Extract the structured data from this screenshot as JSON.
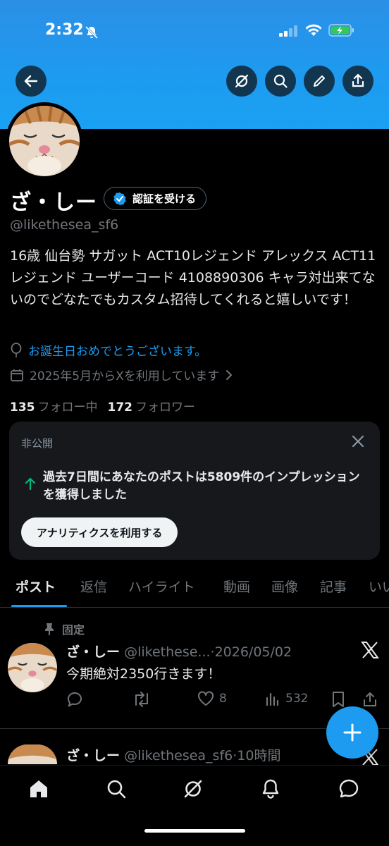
{
  "status_bar": {
    "time": "2:32"
  },
  "profile": {
    "name": "ざ・しー",
    "verify_label": "認証を受ける",
    "handle": "@likethesea_sf6",
    "bio": "16歳 仙台勢 サガット ACT10レジェンド アレックス ACT11レジェンド ユーザーコード 4108890306 キャラ対出来てないのでどなたでもカスタム招待してくれると嬉しいです！",
    "birthday": "お誕生日おめでとうございます。",
    "joined": "2025年5月からXを利用しています",
    "following_count": "135",
    "following_label": "フォロー中",
    "followers_count": "172",
    "followers_label": "フォロワー"
  },
  "private_card": {
    "label": "非公開",
    "text": "過去7日間にあなたのポストは5809件のインプレッションを獲得しました",
    "button": "アナリティクスを利用する"
  },
  "tabs": [
    {
      "label": "ポスト"
    },
    {
      "label": "返信"
    },
    {
      "label": "ハイライト"
    },
    {
      "label": "動画"
    },
    {
      "label": "画像"
    },
    {
      "label": "記事"
    },
    {
      "label": "いい"
    }
  ],
  "posts": [
    {
      "pinned_label": "固定",
      "name": "ざ・しー",
      "handle": "@likethese...",
      "separator": "·",
      "date": "2026/05/02",
      "text": "今期絶対2350行きます！",
      "likes": "8",
      "views": "532"
    },
    {
      "name": "ざ・しー",
      "handle": "@likethesea_sf6",
      "separator": "·",
      "date": "10時間"
    }
  ],
  "colors": {
    "accent": "#1d9bf0",
    "background": "#000000",
    "card": "#16181c",
    "muted": "#71767b"
  }
}
